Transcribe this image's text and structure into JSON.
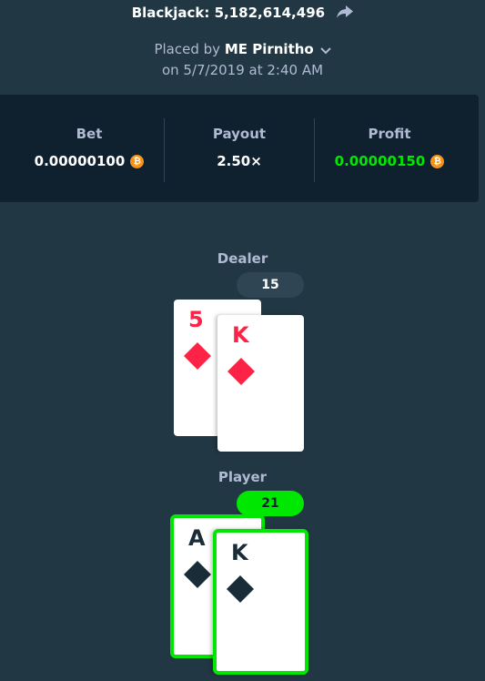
{
  "header": {
    "title": "Blackjack: 5,182,614,496",
    "placed_by_prefix": "Placed by",
    "user": "ME Pirnitho",
    "date": "on 5/7/2019 at 2:40 AM"
  },
  "stats": {
    "bet_label": "Bet",
    "bet_value": "0.00000100",
    "payout_label": "Payout",
    "payout_value": "2.50×",
    "profit_label": "Profit",
    "profit_value": "0.00000150",
    "currency_icon": "bitcoin-icon"
  },
  "dealer": {
    "label": "Dealer",
    "score": "15",
    "cards": [
      {
        "rank": "5",
        "suit": "diamonds"
      },
      {
        "rank": "K",
        "suit": "diamonds"
      }
    ]
  },
  "player": {
    "label": "Player",
    "score": "21",
    "cards": [
      {
        "rank": "A",
        "suit": "spades"
      },
      {
        "rank": "K",
        "suit": "spades"
      }
    ]
  },
  "colors": {
    "background": "#213743",
    "panel": "#0f212e",
    "win_green": "#00e701",
    "red_suit": "#fe2247",
    "black_suit": "#1a2c38",
    "bitcoin": "#f7931a"
  }
}
